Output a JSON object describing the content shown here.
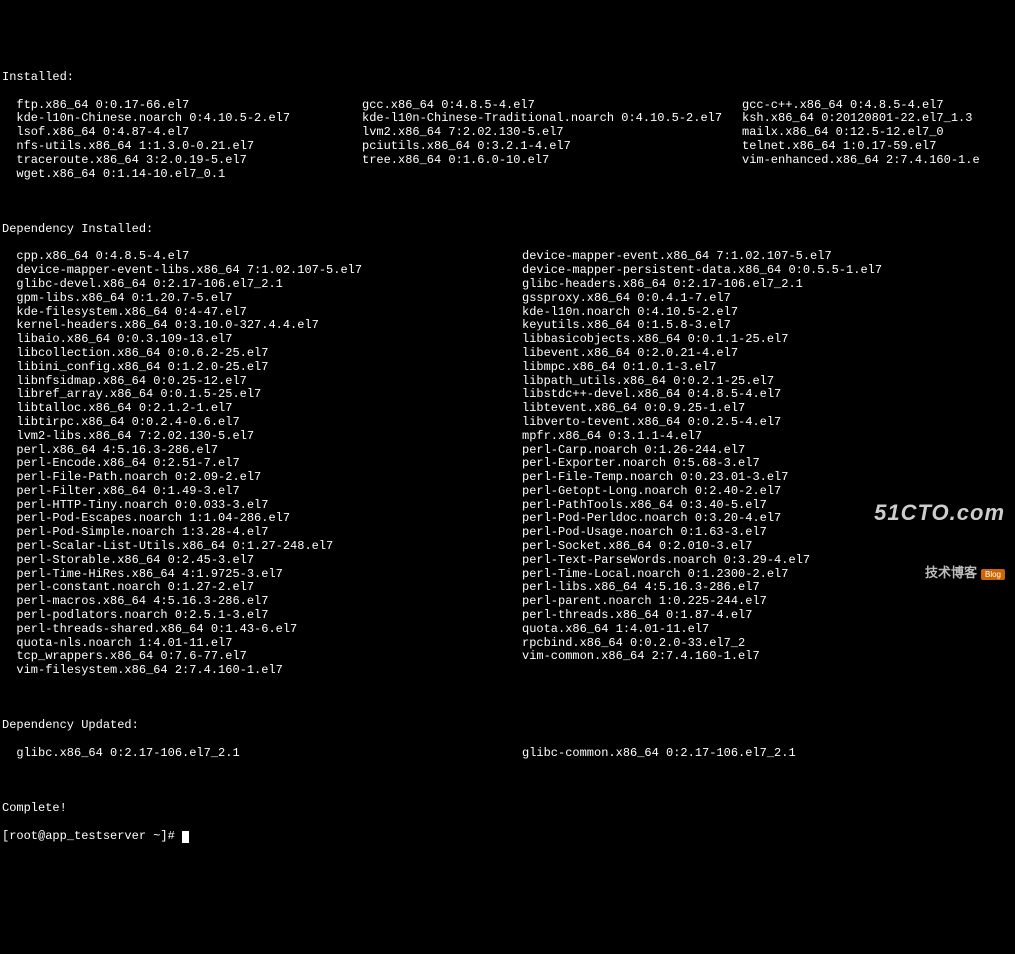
{
  "sections": {
    "installed_header": "Installed:",
    "installed_rows": [
      [
        "  ftp.x86_64 0:0.17-66.el7",
        "gcc.x86_64 0:4.8.5-4.el7",
        "gcc-c++.x86_64 0:4.8.5-4.el7"
      ],
      [
        "  kde-l10n-Chinese.noarch 0:4.10.5-2.el7",
        "kde-l10n-Chinese-Traditional.noarch 0:4.10.5-2.el7",
        "ksh.x86_64 0:20120801-22.el7_1.3"
      ],
      [
        "  lsof.x86_64 0:4.87-4.el7",
        "lvm2.x86_64 7:2.02.130-5.el7",
        "mailx.x86_64 0:12.5-12.el7_0"
      ],
      [
        "  nfs-utils.x86_64 1:1.3.0-0.21.el7",
        "pciutils.x86_64 0:3.2.1-4.el7",
        "telnet.x86_64 1:0.17-59.el7"
      ],
      [
        "  traceroute.x86_64 3:2.0.19-5.el7",
        "tree.x86_64 0:1.6.0-10.el7",
        "vim-enhanced.x86_64 2:7.4.160-1.e"
      ],
      [
        "  wget.x86_64 0:1.14-10.el7_0.1",
        "",
        ""
      ]
    ],
    "dep_installed_header": "Dependency Installed:",
    "dep_installed_rows": [
      [
        "  cpp.x86_64 0:4.8.5-4.el7",
        "device-mapper-event.x86_64 7:1.02.107-5.el7"
      ],
      [
        "  device-mapper-event-libs.x86_64 7:1.02.107-5.el7",
        "device-mapper-persistent-data.x86_64 0:0.5.5-1.el7"
      ],
      [
        "  glibc-devel.x86_64 0:2.17-106.el7_2.1",
        "glibc-headers.x86_64 0:2.17-106.el7_2.1"
      ],
      [
        "  gpm-libs.x86_64 0:1.20.7-5.el7",
        "gssproxy.x86_64 0:0.4.1-7.el7"
      ],
      [
        "  kde-filesystem.x86_64 0:4-47.el7",
        "kde-l10n.noarch 0:4.10.5-2.el7"
      ],
      [
        "  kernel-headers.x86_64 0:3.10.0-327.4.4.el7",
        "keyutils.x86_64 0:1.5.8-3.el7"
      ],
      [
        "  libaio.x86_64 0:0.3.109-13.el7",
        "libbasicobjects.x86_64 0:0.1.1-25.el7"
      ],
      [
        "  libcollection.x86_64 0:0.6.2-25.el7",
        "libevent.x86_64 0:2.0.21-4.el7"
      ],
      [
        "  libini_config.x86_64 0:1.2.0-25.el7",
        "libmpc.x86_64 0:1.0.1-3.el7"
      ],
      [
        "  libnfsidmap.x86_64 0:0.25-12.el7",
        "libpath_utils.x86_64 0:0.2.1-25.el7"
      ],
      [
        "  libref_array.x86_64 0:0.1.5-25.el7",
        "libstdc++-devel.x86_64 0:4.8.5-4.el7"
      ],
      [
        "  libtalloc.x86_64 0:2.1.2-1.el7",
        "libtevent.x86_64 0:0.9.25-1.el7"
      ],
      [
        "  libtirpc.x86_64 0:0.2.4-0.6.el7",
        "libverto-tevent.x86_64 0:0.2.5-4.el7"
      ],
      [
        "  lvm2-libs.x86_64 7:2.02.130-5.el7",
        "mpfr.x86_64 0:3.1.1-4.el7"
      ],
      [
        "  perl.x86_64 4:5.16.3-286.el7",
        "perl-Carp.noarch 0:1.26-244.el7"
      ],
      [
        "  perl-Encode.x86_64 0:2.51-7.el7",
        "perl-Exporter.noarch 0:5.68-3.el7"
      ],
      [
        "  perl-File-Path.noarch 0:2.09-2.el7",
        "perl-File-Temp.noarch 0:0.23.01-3.el7"
      ],
      [
        "  perl-Filter.x86_64 0:1.49-3.el7",
        "perl-Getopt-Long.noarch 0:2.40-2.el7"
      ],
      [
        "  perl-HTTP-Tiny.noarch 0:0.033-3.el7",
        "perl-PathTools.x86_64 0:3.40-5.el7"
      ],
      [
        "  perl-Pod-Escapes.noarch 1:1.04-286.el7",
        "perl-Pod-Perldoc.noarch 0:3.20-4.el7"
      ],
      [
        "  perl-Pod-Simple.noarch 1:3.28-4.el7",
        "perl-Pod-Usage.noarch 0:1.63-3.el7"
      ],
      [
        "  perl-Scalar-List-Utils.x86_64 0:1.27-248.el7",
        "perl-Socket.x86_64 0:2.010-3.el7"
      ],
      [
        "  perl-Storable.x86_64 0:2.45-3.el7",
        "perl-Text-ParseWords.noarch 0:3.29-4.el7"
      ],
      [
        "  perl-Time-HiRes.x86_64 4:1.9725-3.el7",
        "perl-Time-Local.noarch 0:1.2300-2.el7"
      ],
      [
        "  perl-constant.noarch 0:1.27-2.el7",
        "perl-libs.x86_64 4:5.16.3-286.el7"
      ],
      [
        "  perl-macros.x86_64 4:5.16.3-286.el7",
        "perl-parent.noarch 1:0.225-244.el7"
      ],
      [
        "  perl-podlators.noarch 0:2.5.1-3.el7",
        "perl-threads.x86_64 0:1.87-4.el7"
      ],
      [
        "  perl-threads-shared.x86_64 0:1.43-6.el7",
        "quota.x86_64 1:4.01-11.el7"
      ],
      [
        "  quota-nls.noarch 1:4.01-11.el7",
        "rpcbind.x86_64 0:0.2.0-33.el7_2"
      ],
      [
        "  tcp_wrappers.x86_64 0:7.6-77.el7",
        "vim-common.x86_64 2:7.4.160-1.el7"
      ],
      [
        "  vim-filesystem.x86_64 2:7.4.160-1.el7",
        ""
      ]
    ],
    "dep_updated_header": "Dependency Updated:",
    "dep_updated_rows": [
      [
        "  glibc.x86_64 0:2.17-106.el7_2.1",
        "glibc-common.x86_64 0:2.17-106.el7_2.1"
      ]
    ],
    "complete": "Complete!",
    "prompt": "[root@app_testserver ~]#"
  },
  "watermark": {
    "domain": "51CTO.com",
    "sub": "技术博客",
    "badge": "Blog"
  }
}
